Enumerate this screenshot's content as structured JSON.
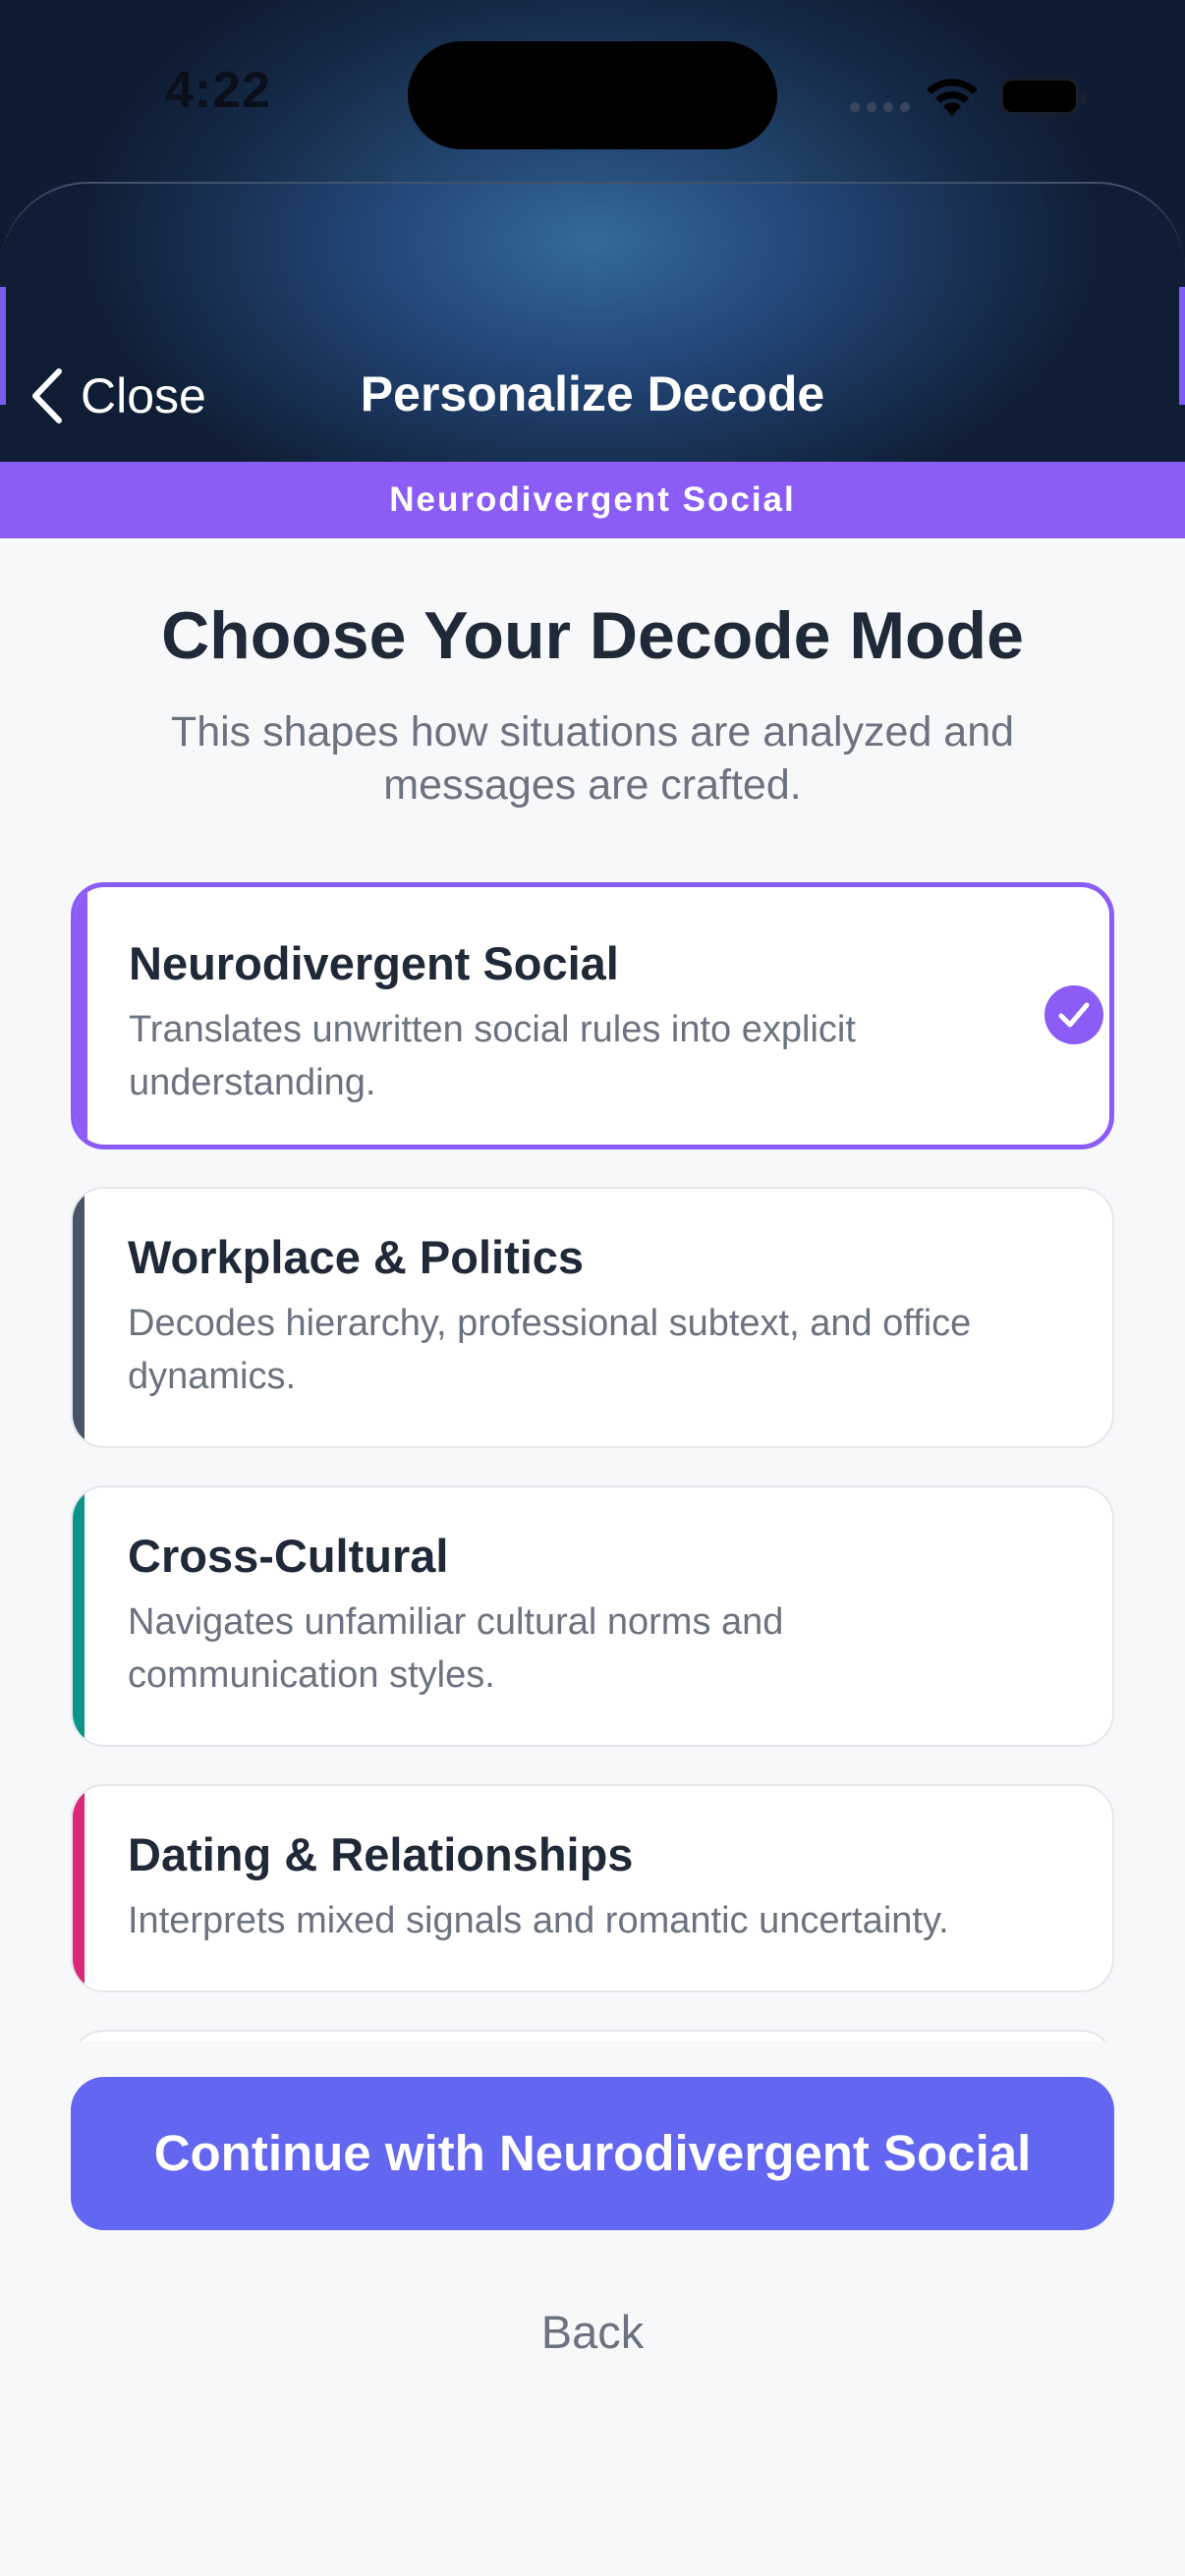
{
  "status_bar": {
    "time": "4:22",
    "icons": [
      "signal-icon",
      "wifi-icon",
      "battery-icon"
    ]
  },
  "header": {
    "close_label": "Close",
    "close_icon": "chevron-left-icon",
    "title": "Personalize Decode"
  },
  "banner": {
    "label": "Neurodivergent Social",
    "color": "#8b5cf6"
  },
  "intro": {
    "heading": "Choose Your Decode Mode",
    "subheading": "This shapes how situations are analyzed and messages are crafted."
  },
  "modes": [
    {
      "title": "Neurodivergent Social",
      "description": "Translates unwritten social rules into explicit understanding.",
      "accent": "#8b5cf6",
      "selected": true
    },
    {
      "title": "Workplace & Politics",
      "description": "Decodes hierarchy, professional subtext, and office dynamics.",
      "accent": "#475569",
      "selected": false
    },
    {
      "title": "Cross-Cultural",
      "description": "Navigates unfamiliar cultural norms and communication styles.",
      "accent": "#0d9488",
      "selected": false
    },
    {
      "title": "Dating & Relationships",
      "description": "Interprets mixed signals and romantic uncertainty.",
      "accent": "#db2777",
      "selected": false
    }
  ],
  "actions": {
    "continue_label": "Continue with Neurodivergent Social",
    "continue_color": "#6366f1",
    "back_label": "Back"
  }
}
